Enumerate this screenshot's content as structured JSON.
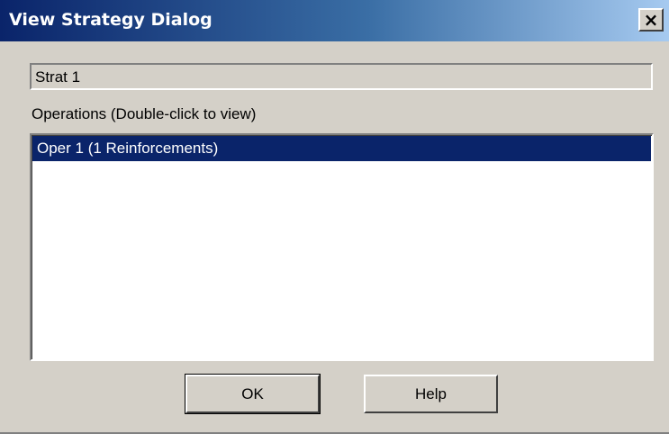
{
  "window": {
    "title": "View Strategy Dialog",
    "close_label": "×",
    "close_icon": "close-icon"
  },
  "strategy": {
    "name": "Strat 1"
  },
  "operations": {
    "label": "Operations (Double-click to view)",
    "items": [
      {
        "label": "Oper 1 (1 Reinforcements)",
        "selected": true
      }
    ]
  },
  "buttons": {
    "ok_label": "OK",
    "help_label": "Help"
  },
  "colors": {
    "titlebar_start": "#0a246a",
    "titlebar_end": "#a6caf0",
    "selection": "#0a246a",
    "face": "#d4d0c8"
  }
}
